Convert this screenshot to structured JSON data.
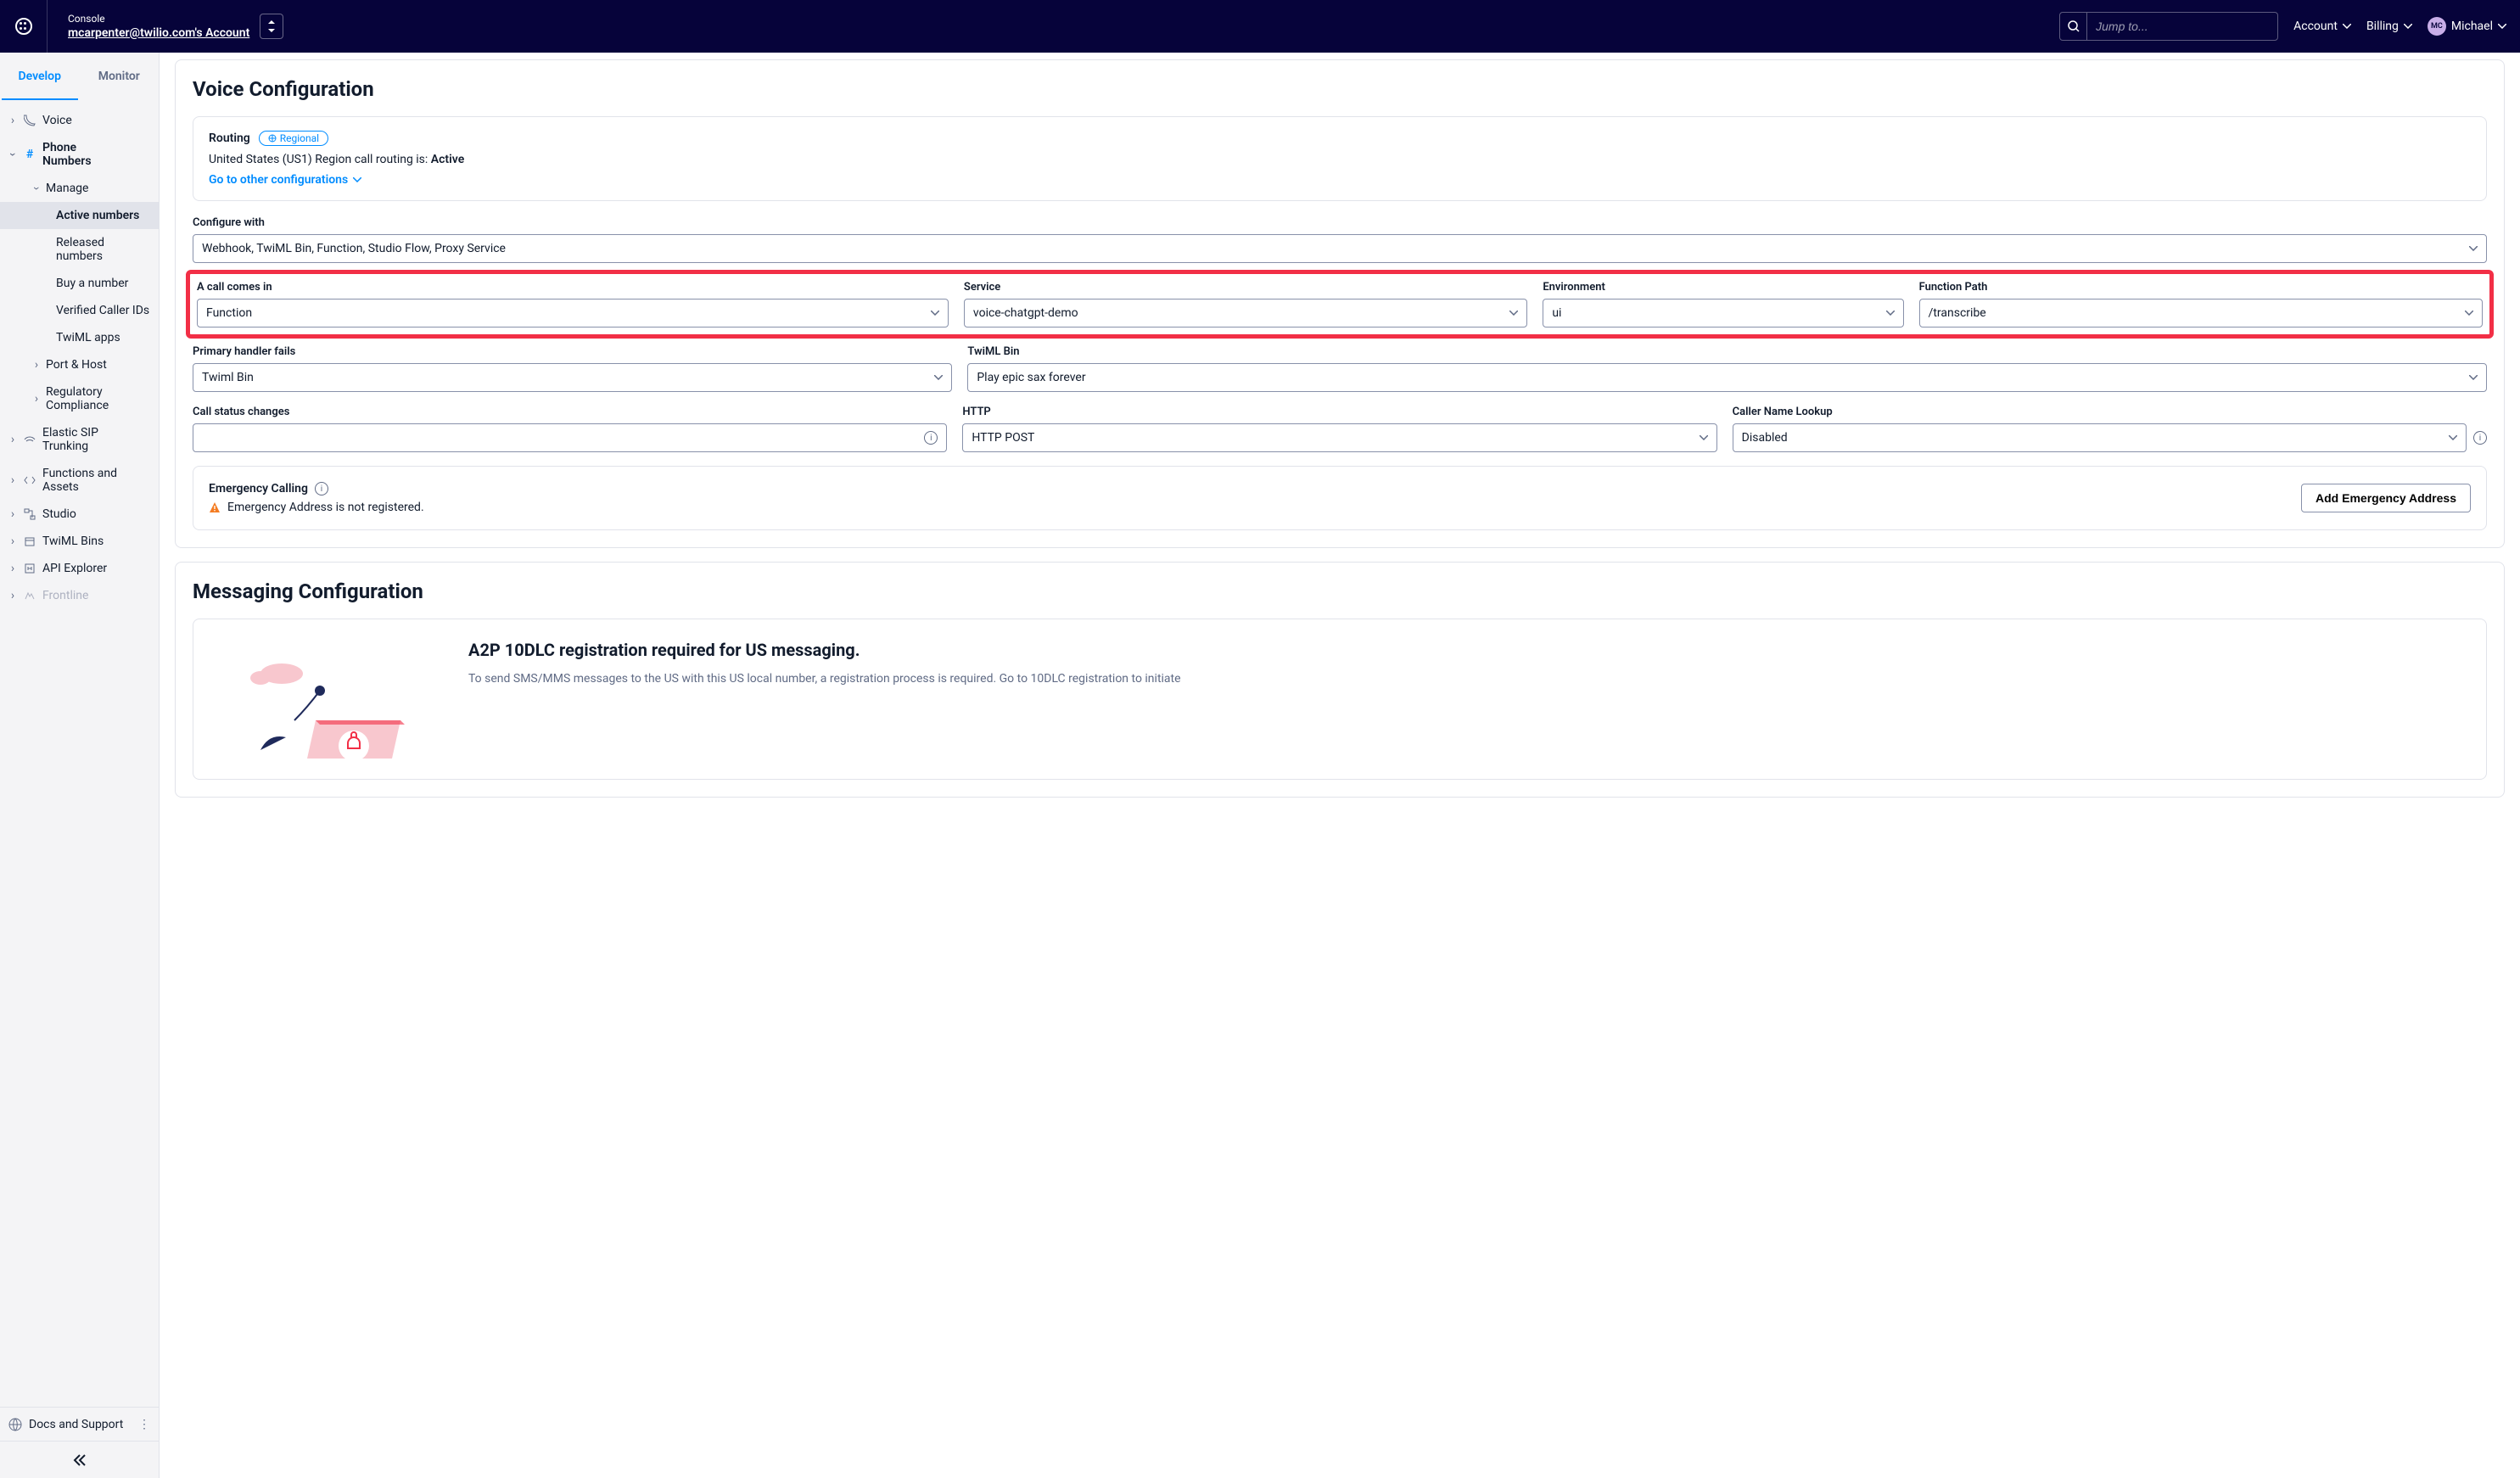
{
  "header": {
    "console_label": "Console",
    "account_name": "mcarpenter@twilio.com's Account",
    "search_placeholder": "Jump to...",
    "links": {
      "account": "Account",
      "billing": "Billing"
    },
    "user": {
      "initials": "MC",
      "name": "Michael"
    }
  },
  "sidebar": {
    "tabs": {
      "develop": "Develop",
      "monitor": "Monitor"
    },
    "items": {
      "voice": "Voice",
      "phone_numbers": "Phone Numbers",
      "manage": "Manage",
      "active_numbers": "Active numbers",
      "released_numbers": "Released numbers",
      "buy_number": "Buy a number",
      "verified_caller_ids": "Verified Caller IDs",
      "twiml_apps": "TwiML apps",
      "port_host": "Port & Host",
      "regulatory": "Regulatory Compliance",
      "elastic_sip": "Elastic SIP Trunking",
      "functions_assets": "Functions and Assets",
      "studio": "Studio",
      "twiml_bins": "TwiML Bins",
      "api_explorer": "API Explorer",
      "frontline": "Frontline"
    },
    "footer": {
      "docs_support": "Docs and Support"
    }
  },
  "voice_config": {
    "title": "Voice Configuration",
    "routing": {
      "label": "Routing",
      "badge": "Regional",
      "text_prefix": "United States (US1) Region call routing is: ",
      "text_status": "Active",
      "link": "Go to other configurations"
    },
    "configure_with": {
      "label": "Configure with",
      "value": "Webhook, TwiML Bin, Function, Studio Flow, Proxy Service"
    },
    "call_comes_in": {
      "label": "A call comes in",
      "value": "Function",
      "service_label": "Service",
      "service_value": "voice-chatgpt-demo",
      "env_label": "Environment",
      "env_value": "ui",
      "path_label": "Function Path",
      "path_value": "/transcribe"
    },
    "primary_handler": {
      "label": "Primary handler fails",
      "value": "Twiml Bin",
      "twiml_bin_label": "TwiML Bin",
      "twiml_bin_value": "Play epic sax forever"
    },
    "call_status": {
      "label": "Call status changes",
      "value": "",
      "http_label": "HTTP",
      "http_value": "HTTP POST",
      "caller_lookup_label": "Caller Name Lookup",
      "caller_lookup_value": "Disabled"
    },
    "emergency": {
      "title": "Emergency Calling",
      "warning": "Emergency Address is not registered.",
      "button": "Add Emergency Address"
    }
  },
  "messaging_config": {
    "title": "Messaging Configuration",
    "a2p_title": "A2P 10DLC registration required for US messaging.",
    "a2p_body": "To send SMS/MMS messages to the US with this US local number, a registration process is required. Go to 10DLC registration to initiate"
  }
}
